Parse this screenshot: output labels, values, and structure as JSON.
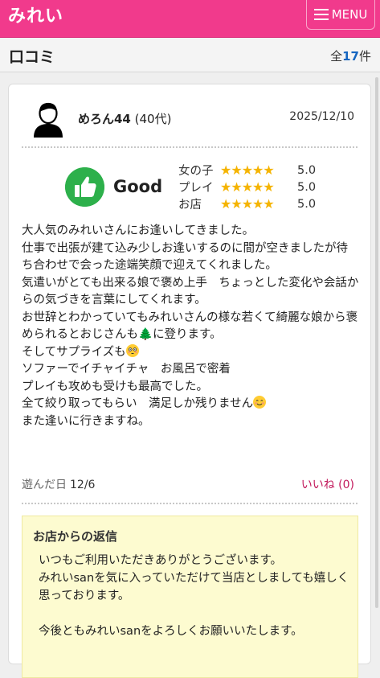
{
  "header": {
    "title": "みれい",
    "menu_label": "MENU"
  },
  "section": {
    "title": "口コミ",
    "count_prefix": "全",
    "count": "17",
    "count_suffix": "件"
  },
  "review": {
    "user_name": "めろん44",
    "user_age": "(40代)",
    "date": "2025/12/10",
    "verdict": "Good",
    "ratings": [
      {
        "label": "女の子",
        "stars": 5,
        "score": "5.0"
      },
      {
        "label": "プレイ",
        "stars": 5,
        "score": "5.0"
      },
      {
        "label": "お店",
        "stars": 5,
        "score": "5.0"
      }
    ],
    "body_1": "大人気のみれいさんにお逢いしてきました。\n仕事で出張が建て込み少しお逢いするのに間が空きましたが待ち合わせで会った途端笑顔で迎えてくれました。\n気遣いがとても出来る娘で褒め上手　ちょっとした変化や会話からの気づきを言葉にしてくれます。\nお世辞とわかっていてもみれいさんの様な若くて綺麗な娘から褒められるとおじさんも",
    "body_2": "に登ります。\nそしてサプライズも",
    "body_3": "\nソファーでイチャイチャ　お風呂で密着\nプレイも攻めも受けも最高でした。\n全て絞り取ってもらい　満足しか残りません",
    "body_4": "\nまた逢いに行きますね。",
    "tree_glyph": "🌲",
    "played_label": "遊んだ日",
    "played_date": "12/6",
    "like_label": "いいね (0)"
  },
  "reply": {
    "heading": "お店からの返信",
    "text": "いつもご利用いただきありがとうございます。\nみれいsanを気に入っていただけて当店としましても嬉しく思っております。\n\n今後ともみれいsanをよろしくお願いいたします。"
  },
  "colors": {
    "brand": "#f13a8c",
    "good": "#2db04b",
    "star": "#f5b400",
    "count": "#1565c0",
    "like": "#c2185b",
    "reply_bg": "#fdfbd0"
  },
  "icons": {
    "menu": "hamburger-icon",
    "good": "thumbs-up-icon",
    "avatar": "user-avatar-icon",
    "star": "star-icon"
  }
}
